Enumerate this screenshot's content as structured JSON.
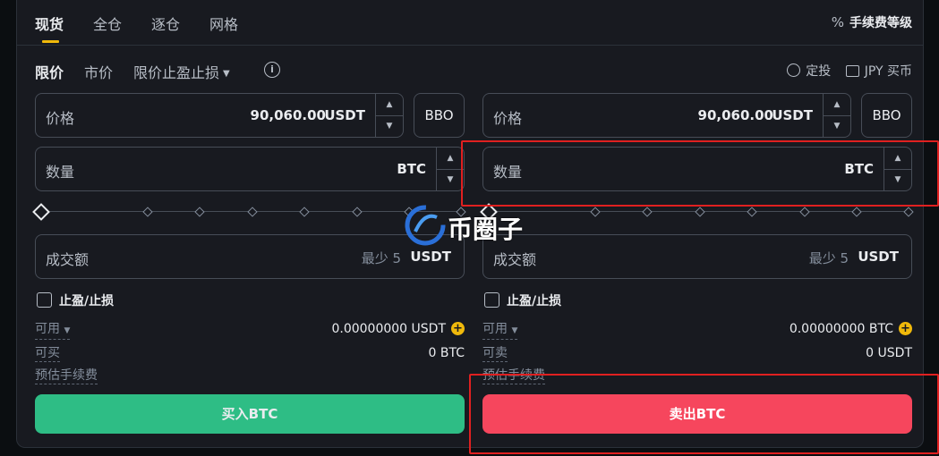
{
  "tabs": [
    {
      "label": "现货"
    },
    {
      "label": "全仓"
    },
    {
      "label": "逐仓"
    },
    {
      "label": "网格"
    }
  ],
  "fee_level": {
    "label": "手续费等级",
    "icon": "percent-icon"
  },
  "order_types": {
    "limit": "限价",
    "market": "市价",
    "tpsl": "限价止盈止损"
  },
  "right_links": {
    "recurring": "定投",
    "buy_fiat": "JPY 买币"
  },
  "buy": {
    "price_label": "价格",
    "price_value": "90,060.00",
    "price_unit": "USDT",
    "bbo": "BBO",
    "amount_label": "数量",
    "amount_unit": "BTC",
    "total_label": "成交额",
    "total_min": "最少 5",
    "total_unit": "USDT",
    "tpsl_label": "止盈/止损",
    "avail_label": "可用",
    "avail_value": "0.00000000 USDT",
    "max_label": "可买",
    "max_value": "0 BTC",
    "fee_label": "预估手续费",
    "button": "买入BTC"
  },
  "sell": {
    "price_label": "价格",
    "price_value": "90,060.00",
    "price_unit": "USDT",
    "bbo": "BBO",
    "amount_label": "数量",
    "amount_unit": "BTC",
    "total_label": "成交额",
    "total_min": "最少 5",
    "total_unit": "USDT",
    "tpsl_label": "止盈/止损",
    "avail_label": "可用",
    "avail_value": "0.00000000 BTC",
    "max_label": "可卖",
    "max_value": "0 USDT",
    "fee_label": "预估手续费",
    "button": "卖出BTC"
  },
  "watermark": {
    "text": "币圈子"
  },
  "colors": {
    "accent": "#f0b90b",
    "buy": "#2ebd85",
    "sell": "#f6465d",
    "highlight": "#e02020"
  }
}
